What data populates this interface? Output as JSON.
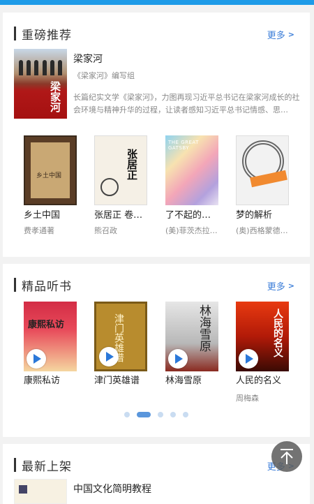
{
  "sections": {
    "featured": {
      "title": "重磅推荐",
      "more": "更多",
      "main_book": {
        "title": "梁家河",
        "author": "《梁家河》编写组",
        "description": "长篇纪实文学《梁家河》，力图再现习近平总书记在梁家河成长的社会环境与精神升华的过程，让读者感知习近平总书记情感、思…",
        "cover_text": "梁家河"
      },
      "books": [
        {
          "title": "乡土中国",
          "author": "费孝通著",
          "cover_text": "乡土中国"
        },
        {
          "title": "张居正 卷…",
          "author": "熊召政",
          "cover_text": "张居正"
        },
        {
          "title": "了不起的…",
          "author": "(美)菲茨杰拉…",
          "cover_text": "THE GREAT GATSBY"
        },
        {
          "title": "梦的解析",
          "author": "(奥)西格蒙德…",
          "cover_text": ""
        }
      ]
    },
    "audio": {
      "title": "精品听书",
      "more": "更多",
      "books": [
        {
          "title": "康熙私访",
          "author": "",
          "cover_text": "康熙私访"
        },
        {
          "title": "津门英雄谱",
          "author": "",
          "cover_text": "津门英雄谱"
        },
        {
          "title": "林海雪原",
          "author": "",
          "cover_text": "林海雪原"
        },
        {
          "title": "人民的名义",
          "author": "周梅森",
          "cover_text": "人民的名义"
        }
      ],
      "pager": {
        "count": 5,
        "active": 1
      }
    },
    "new": {
      "title": "最新上架",
      "more": "更多",
      "first_book": {
        "title": "中国文化简明教程"
      }
    }
  },
  "colors": {
    "accent": "#1e9be8",
    "link": "#3b7dd8",
    "play": "#2b78d9"
  },
  "icons": {
    "more": "chevron-right-icon",
    "play": "play-icon",
    "top": "back-to-top-icon"
  }
}
